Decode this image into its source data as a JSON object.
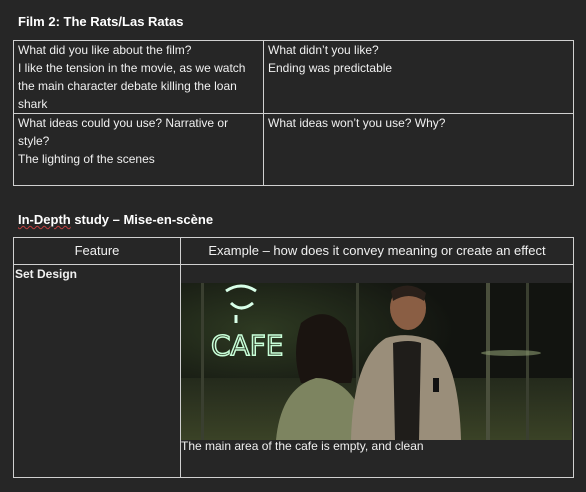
{
  "section1": {
    "title": "Film 2: The Rats/Las Ratas",
    "q_like": "What did you like about the film?",
    "a_like": [
      "I like the tension in the movie, as we watch",
      "the main character debate killing the loan",
      "shark"
    ],
    "q_dislike": "What didn’t you like?",
    "a_dislike": "Ending was predictable",
    "q_use": [
      "What ideas could you use? Narrative or",
      "style?"
    ],
    "a_use": "The lighting of the scenes",
    "q_wont": "What ideas won’t you use? Why?"
  },
  "section2": {
    "title_prefix": "In-Depth",
    "title_rest": " study – Mise-en-scène",
    "col_feature": "Feature",
    "col_example": "Example – how does it convey meaning or create an effect",
    "row_label": "Set Design",
    "caption": "The main area of the cafe is empty, and clean",
    "sign_text": "CAFE"
  }
}
